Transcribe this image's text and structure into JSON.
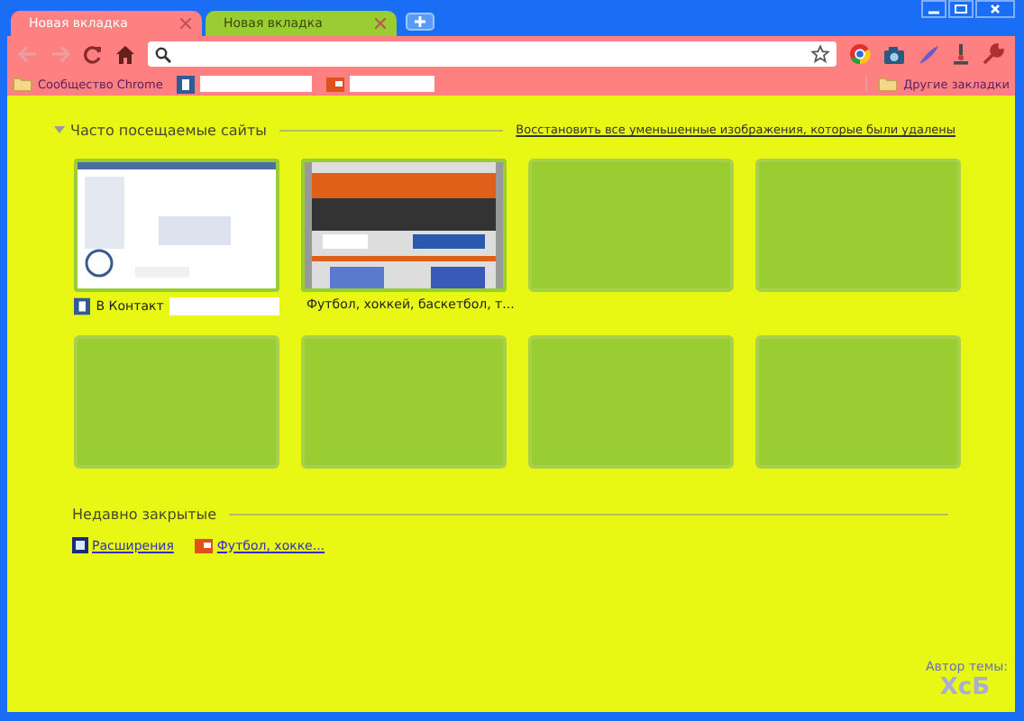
{
  "tabs": [
    {
      "title": "Новая вкладка",
      "selected": true
    },
    {
      "title": "Новая вкладка",
      "selected": false
    }
  ],
  "bookmarks": [
    {
      "kind": "folder",
      "label": "Сообщество Chrome"
    },
    {
      "kind": "page"
    },
    {
      "kind": "page"
    }
  ],
  "other_bookmarks": "Другие закладки",
  "most_visited": {
    "title": "Часто посещаемые сайты",
    "restore_link": "Восстановить все уменьшенные изображения, которые были удалены",
    "tiles": [
      {
        "kind": "page",
        "title": "В Контакт"
      },
      {
        "kind": "page",
        "title": "Футбол, хоккей, баскетбол, т..."
      },
      {
        "kind": "empty"
      },
      {
        "kind": "empty"
      },
      {
        "kind": "empty"
      },
      {
        "kind": "empty"
      },
      {
        "kind": "empty"
      },
      {
        "kind": "empty"
      }
    ]
  },
  "recently_closed": {
    "title": "Недавно закрытые",
    "items": [
      {
        "label": "Расширения"
      },
      {
        "label": "Футбол, хокке..."
      }
    ]
  },
  "theme_author": {
    "label": "Автор темы:",
    "name": "XcБ"
  }
}
